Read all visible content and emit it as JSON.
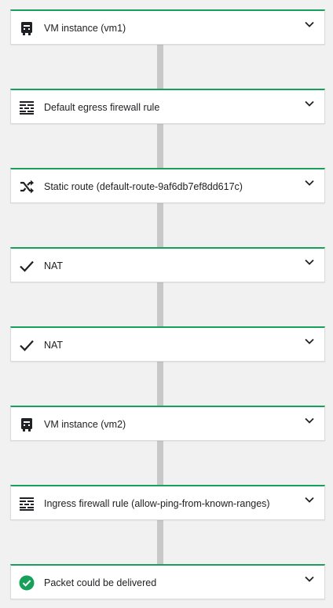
{
  "accent_color": "#16a05a",
  "connector_color": "#c8c8c8",
  "steps": [
    {
      "label": "VM instance (vm1)",
      "icon": "vm-instance-icon"
    },
    {
      "label": "Default egress firewall rule",
      "icon": "firewall-icon"
    },
    {
      "label": "Static route (default-route-9af6db7ef8dd617c)",
      "icon": "shuffle-route-icon"
    },
    {
      "label": "NAT",
      "icon": "check-icon"
    },
    {
      "label": "NAT",
      "icon": "check-icon"
    },
    {
      "label": "VM instance (vm2)",
      "icon": "vm-instance-icon"
    },
    {
      "label": "Ingress firewall rule (allow-ping-from-known-ranges)",
      "icon": "firewall-icon"
    },
    {
      "label": "Packet could be delivered",
      "icon": "check-circle-icon"
    }
  ]
}
